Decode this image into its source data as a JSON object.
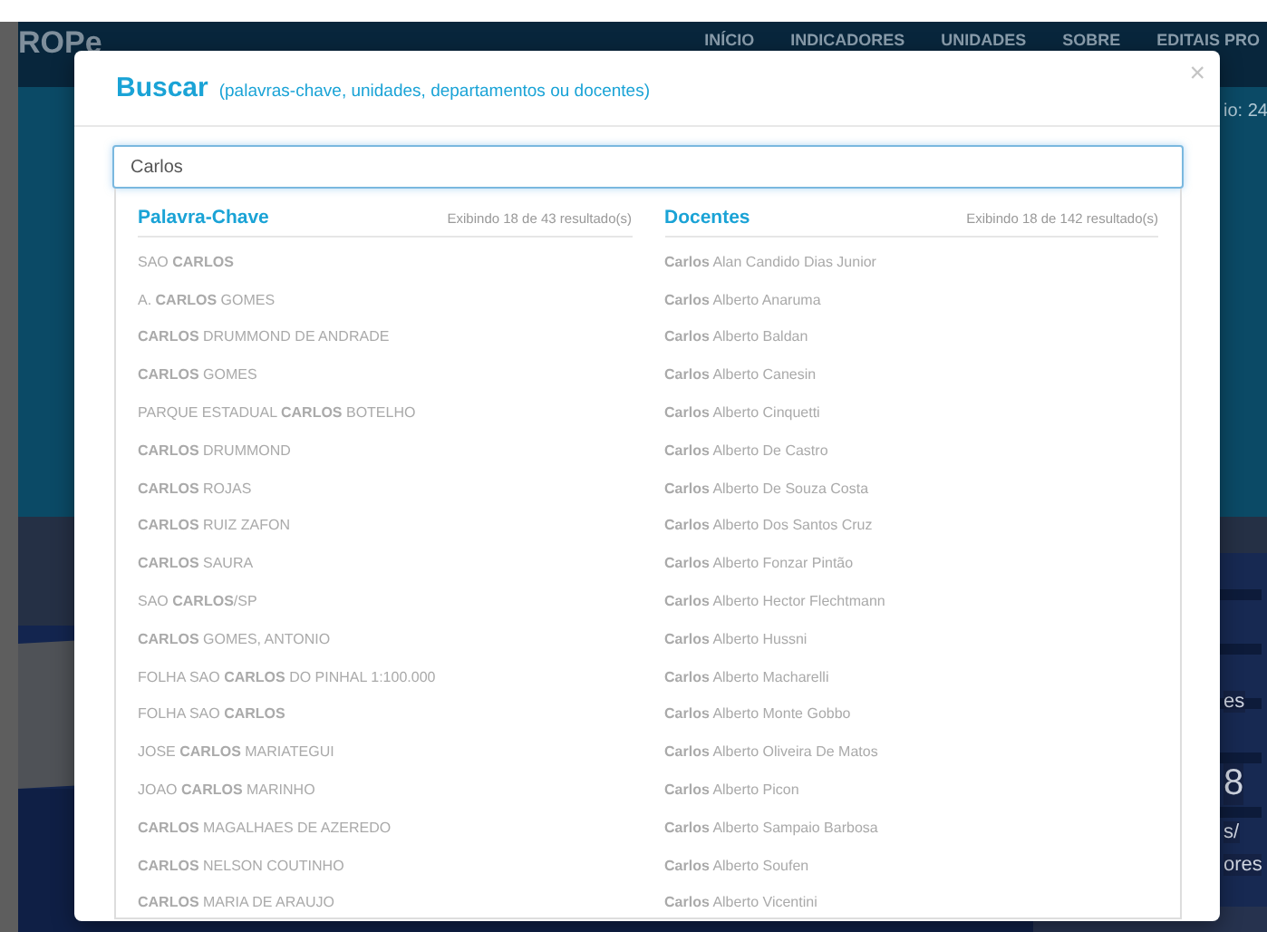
{
  "site": {
    "logo": "ROPe",
    "nav": [
      "INÍCIO",
      "INDICADORES",
      "UNIDADES",
      "SOBRE",
      "EDITAIS PRO"
    ],
    "hero_fragment": "io: 24",
    "photo_fragments": [
      "es",
      "8",
      "s/",
      "ores"
    ],
    "photo": {
      "kind": "picture"
    }
  },
  "modal": {
    "title": "Buscar",
    "subtitle": "(palavras-chave, unidades, departamentos ou docentes)",
    "close": "×",
    "search": {
      "value": "Carlos"
    },
    "columns": [
      {
        "heading": "Palavra-Chave",
        "count": "Exibindo 18 de 43 resultado(s)",
        "items": [
          "SAO **CARLOS**",
          "A. **CARLOS** GOMES",
          "**CARLOS** DRUMMOND DE ANDRADE",
          "**CARLOS** GOMES",
          "PARQUE ESTADUAL **CARLOS** BOTELHO",
          "**CARLOS** DRUMMOND",
          "**CARLOS** ROJAS",
          "**CARLOS** RUIZ ZAFON",
          "**CARLOS** SAURA",
          "SAO **CARLOS**/SP",
          "**CARLOS** GOMES, ANTONIO",
          "FOLHA SAO **CARLOS** DO PINHAL 1:100.000",
          "FOLHA SAO **CARLOS**",
          "JOSE **CARLOS** MARIATEGUI",
          "JOAO **CARLOS** MARINHO",
          "**CARLOS** MAGALHAES DE AZEREDO",
          "**CARLOS** NELSON COUTINHO",
          "**CARLOS** MARIA DE ARAUJO"
        ]
      },
      {
        "heading": "Docentes",
        "count": "Exibindo 18 de 142 resultado(s)",
        "items": [
          "**Carlos** Alan Candido Dias Junior",
          "**Carlos** Alberto Anaruma",
          "**Carlos** Alberto Baldan",
          "**Carlos** Alberto Canesin",
          "**Carlos** Alberto Cinquetti",
          "**Carlos** Alberto De Castro",
          "**Carlos** Alberto De Souza Costa",
          "**Carlos** Alberto Dos Santos Cruz",
          "**Carlos** Alberto Fonzar Pintão",
          "**Carlos** Alberto Hector Flechtmann",
          "**Carlos** Alberto Hussni",
          "**Carlos** Alberto Macharelli",
          "**Carlos** Alberto Monte Gobbo",
          "**Carlos** Alberto Oliveira De Matos",
          "**Carlos** Alberto Picon",
          "**Carlos** Alberto Sampaio Barbosa",
          "**Carlos** Alberto Soufen",
          "**Carlos** Alberto Vicentini"
        ]
      }
    ]
  }
}
